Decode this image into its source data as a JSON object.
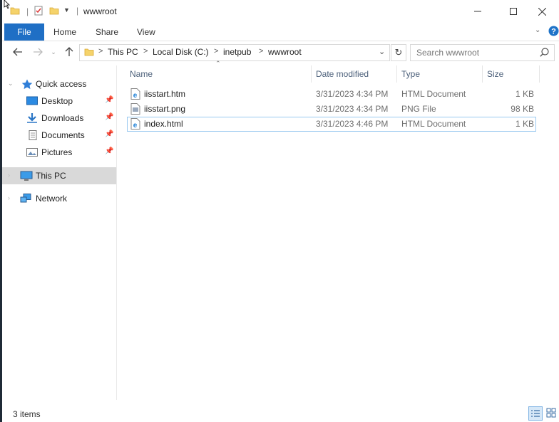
{
  "window": {
    "title": "wwwroot",
    "controls": [
      "minimize",
      "maximize",
      "close"
    ]
  },
  "ribbon": {
    "tabs": [
      "File",
      "Home",
      "Share",
      "View"
    ]
  },
  "address": {
    "crumbs": [
      "This PC",
      "Local Disk (C:)",
      "inetpub",
      "wwwroot"
    ],
    "search_placeholder": "Search wwwroot"
  },
  "navpane": {
    "quick_access": "Quick access",
    "pinned": [
      {
        "label": "Desktop",
        "icon": "desktop-icon"
      },
      {
        "label": "Downloads",
        "icon": "downloads-icon"
      },
      {
        "label": "Documents",
        "icon": "documents-icon"
      },
      {
        "label": "Pictures",
        "icon": "pictures-icon"
      }
    ],
    "this_pc": "This PC",
    "network": "Network"
  },
  "columns": [
    "Name",
    "Date modified",
    "Type",
    "Size"
  ],
  "files": [
    {
      "name": "iisstart.htm",
      "date": "3/31/2023 4:34 PM",
      "type": "HTML Document",
      "size": "1 KB",
      "icon": "ie-html-icon"
    },
    {
      "name": "iisstart.png",
      "date": "3/31/2023 4:34 PM",
      "type": "PNG File",
      "size": "98 KB",
      "icon": "png-file-icon"
    },
    {
      "name": "index.html",
      "date": "3/31/2023 4:46 PM",
      "type": "HTML Document",
      "size": "1 KB",
      "icon": "ie-html-icon"
    }
  ],
  "status": {
    "item_count": "3 items"
  },
  "colors": {
    "file_tab": "#1f6fc5",
    "selected_nav": "#d9d9d9",
    "focus_border": "#99c8f0",
    "header_text": "#4c607a",
    "help": "#1e73c8"
  }
}
